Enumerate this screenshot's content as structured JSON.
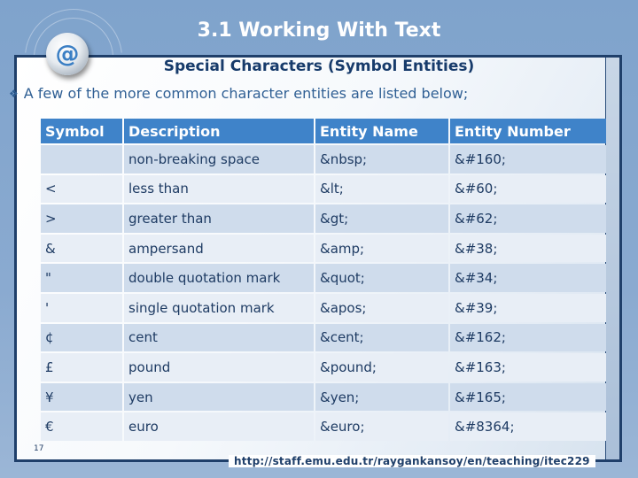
{
  "slide": {
    "title": "3.1 Working With Text",
    "subtitle": "Special Characters (Symbol Entities)",
    "bullet": "A few of the more common character entities are listed below;",
    "logo_glyph": "@",
    "bullet_icon": "❖",
    "page_number": "17",
    "url": "http://staff.emu.edu.tr/raygankansoy/en/teaching/itec229"
  },
  "colors": {
    "header_bg": "#3f83c9",
    "row_dark": "#cfdcec",
    "row_light": "#e8eef6",
    "frame_border": "#1f3f6a",
    "text": "#1e3b63"
  },
  "table": {
    "headers": [
      "Symbol",
      "Description",
      "Entity Name",
      "Entity Number"
    ],
    "rows": [
      {
        "symbol": "",
        "description": "non-breaking space",
        "name": "&nbsp;",
        "number": "&#160;"
      },
      {
        "symbol": "<",
        "description": "less than",
        "name": "&lt;",
        "number": "&#60;"
      },
      {
        "symbol": ">",
        "description": "greater than",
        "name": "&gt;",
        "number": "&#62;"
      },
      {
        "symbol": "&",
        "description": "ampersand",
        "name": "&amp;",
        "number": "&#38;"
      },
      {
        "symbol": "\"",
        "description": "double quotation mark",
        "name": "&quot;",
        "number": "&#34;"
      },
      {
        "symbol": "'",
        "description": "single quotation mark",
        "name": "&apos;",
        "number": "&#39;"
      },
      {
        "symbol": "¢",
        "description": "cent",
        "name": "&cent;",
        "number": "&#162;"
      },
      {
        "symbol": "£",
        "description": "pound",
        "name": "&pound;",
        "number": "&#163;"
      },
      {
        "symbol": "¥",
        "description": "yen",
        "name": "&yen;",
        "number": "&#165;"
      },
      {
        "symbol": "€",
        "description": "euro",
        "name": "&euro;",
        "number": "&#8364;"
      }
    ]
  }
}
